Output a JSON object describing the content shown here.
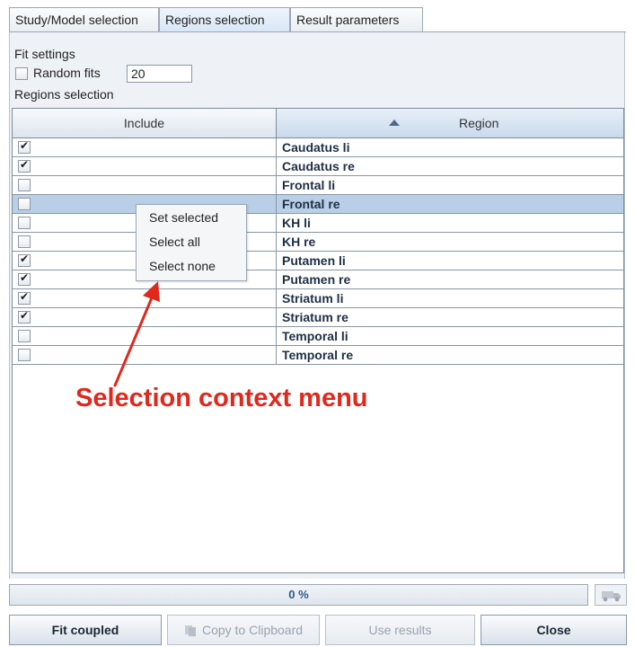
{
  "tabs": [
    {
      "label": "Study/Model selection"
    },
    {
      "label": "Regions selection",
      "active": true
    },
    {
      "label": "Result parameters"
    }
  ],
  "fit_settings": {
    "title": "Fit settings",
    "random_fits_label": "Random fits",
    "random_fits_checked": false,
    "random_fits_value": "20"
  },
  "regions_section_label": "Regions selection",
  "table": {
    "columns": [
      "Include",
      "Region"
    ],
    "sort_column": "Region",
    "sort_direction": "ascending",
    "rows": [
      {
        "include": true,
        "region": "Caudatus li"
      },
      {
        "include": true,
        "region": "Caudatus re"
      },
      {
        "include": false,
        "region": "Frontal li"
      },
      {
        "include": false,
        "region": "Frontal re",
        "selected": true
      },
      {
        "include": false,
        "region": "KH li"
      },
      {
        "include": false,
        "region": "KH re"
      },
      {
        "include": true,
        "region": "Putamen li"
      },
      {
        "include": true,
        "region": "Putamen re"
      },
      {
        "include": true,
        "region": "Striatum li"
      },
      {
        "include": true,
        "region": "Striatum re"
      },
      {
        "include": false,
        "region": "Temporal li"
      },
      {
        "include": false,
        "region": "Temporal re"
      }
    ]
  },
  "context_menu": {
    "items": [
      "Set selected",
      "Select all",
      "Select none"
    ]
  },
  "annotation": {
    "text": "Selection context menu",
    "color": "#e0281c"
  },
  "progress": {
    "text": "0 %",
    "value": 0
  },
  "buttons": {
    "fit": "Fit coupled",
    "copy": "Copy to Clipboard",
    "use": "Use results",
    "close": "Close"
  },
  "colors": {
    "selected_row": "#b8cfe7",
    "region_text": "#1e2f44"
  },
  "icons": {
    "copy": "clipboard-icon",
    "vehicle": "truck-icon",
    "sort": "sort-ascending-icon",
    "check": "checkmark-icon"
  }
}
